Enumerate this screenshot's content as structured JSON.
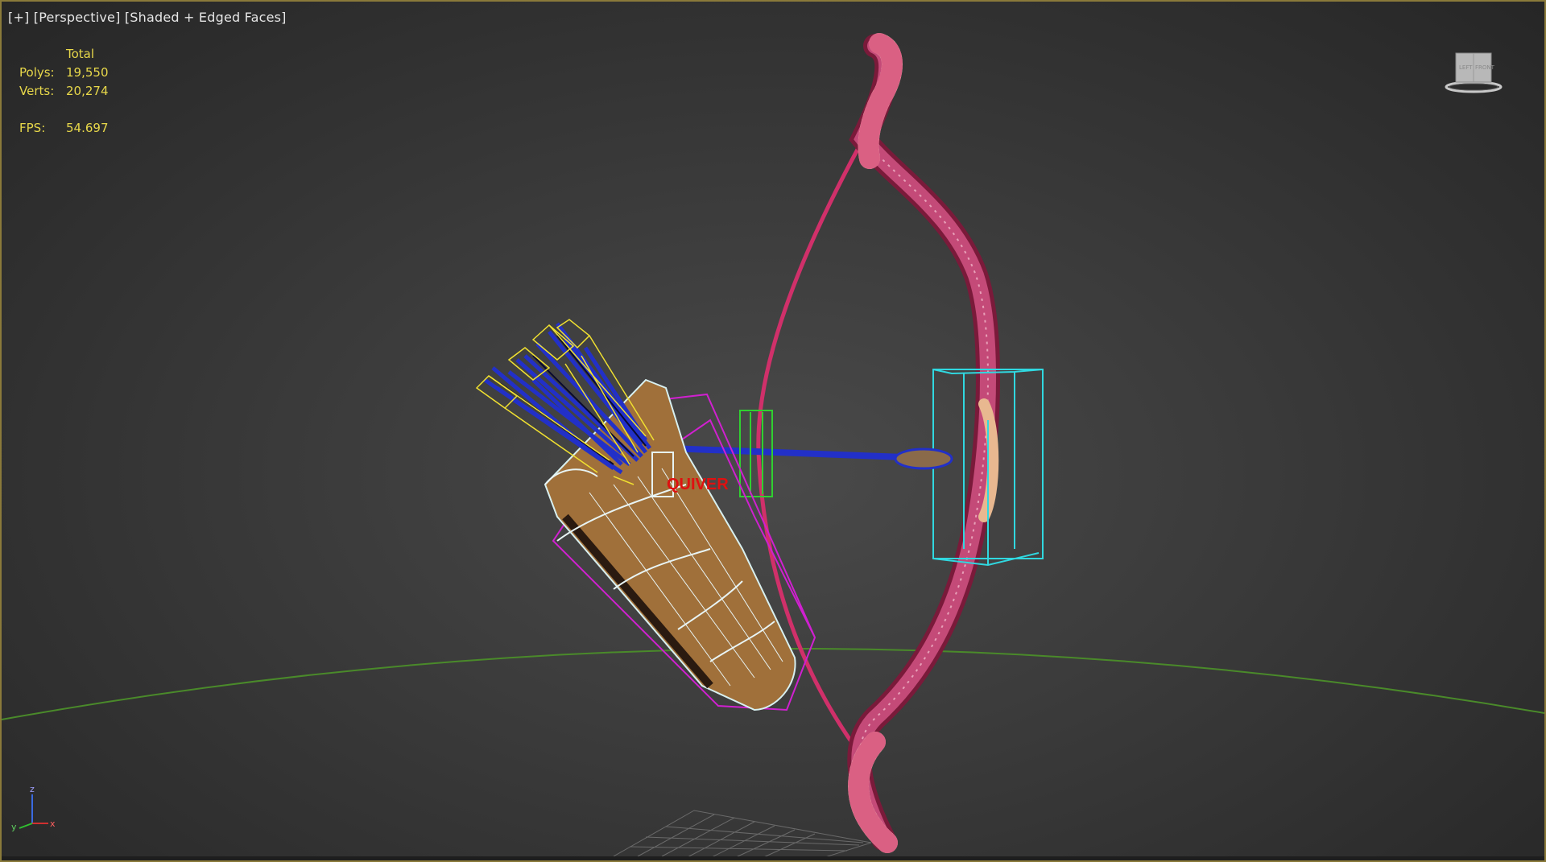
{
  "viewport": {
    "label_plus": "[+]",
    "label_view": "[Perspective]",
    "label_shading": "[Shaded + Edged Faces]"
  },
  "stats": {
    "header": "Total",
    "polys_label": "Polys:",
    "polys_value": "19,550",
    "verts_label": "Verts:",
    "verts_value": "20,274",
    "fps_label": "FPS:",
    "fps_value": "54.697"
  },
  "viewcube": {
    "icon": "viewcube-icon",
    "face_left": "LEFT",
    "face_front": "FRONT"
  },
  "axis": {
    "x": "x",
    "y": "y",
    "z": "z"
  },
  "scene_text": {
    "quiver_label": "QUIVER"
  },
  "colors": {
    "viewport_border": "#8a7a3a",
    "stats_text": "#e8d84a",
    "bow": "#d0306a",
    "quiver_wood": "#a0703a",
    "arrows": "#2230c8",
    "selection_yellow": "#f0e030",
    "bbox_magenta": "#d020d0",
    "bbox_cyan": "#30d8e0",
    "bbox_green": "#30d030",
    "horizon_green": "#4a8a2a"
  }
}
